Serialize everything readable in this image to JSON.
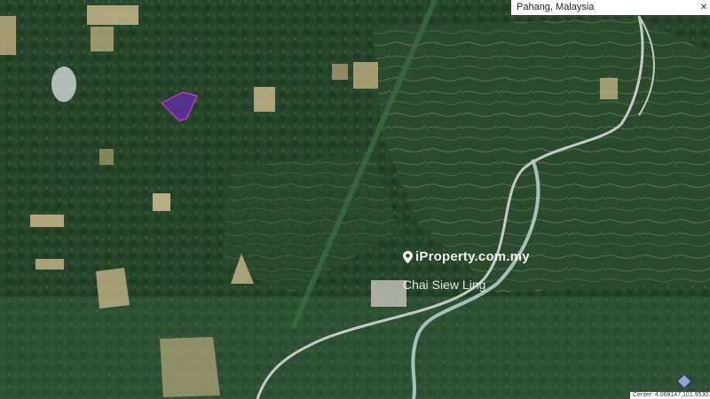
{
  "location_label": "Pahang, Malaysia",
  "close_icon": "close-icon",
  "watermark": {
    "brand": "iProperty.com.my",
    "agent": "Chai Siew Ling",
    "icon": "location-pin-icon"
  },
  "footer": {
    "center_text": "Center: 4.068147,101.953078"
  },
  "colors": {
    "forest_dark": "#1e3a22",
    "forest_mid": "#2d4f2f",
    "clearing": "#c7b58a",
    "road": "#bfc8c4",
    "plot_fill": "#5b2f9a",
    "plot_stroke": "#d23bb0"
  }
}
